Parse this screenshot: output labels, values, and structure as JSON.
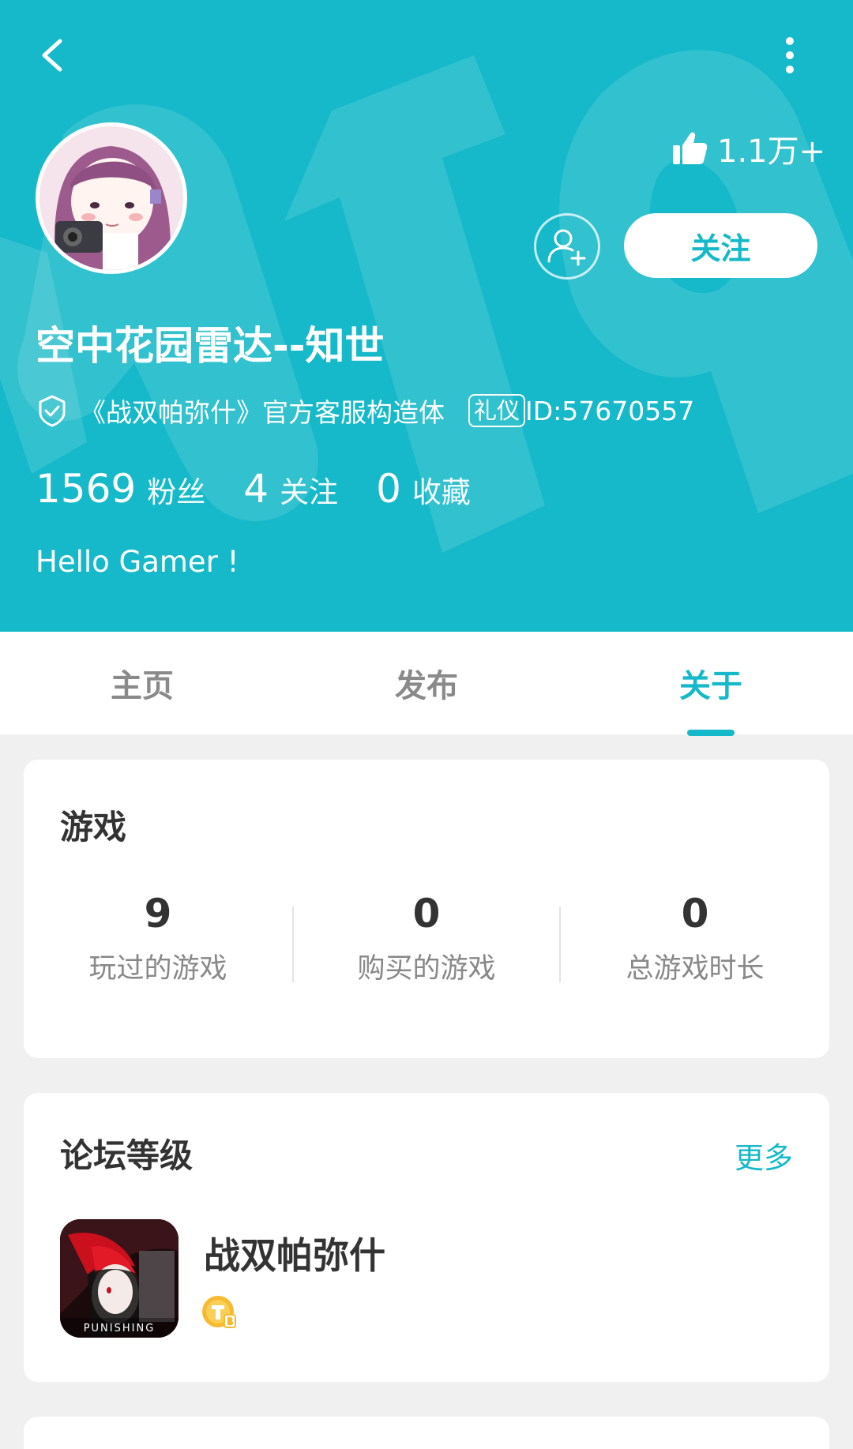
{
  "header": {
    "bg_color": "#15b9c9",
    "likes": "1.1万+",
    "follow_label": "关注",
    "username": "空中花园雷达--知世",
    "verify_text": "《战双帕弥什》官方客服构造体",
    "tag_badge": "礼仪",
    "user_id": "ID:57670557",
    "stats": [
      {
        "value": "1569",
        "label": "粉丝"
      },
      {
        "value": "4",
        "label": "关注"
      },
      {
        "value": "0",
        "label": "收藏"
      }
    ],
    "bio": "Hello Gamer !"
  },
  "tabs": [
    {
      "label": "主页",
      "active": false
    },
    {
      "label": "发布",
      "active": false
    },
    {
      "label": "关于",
      "active": true
    }
  ],
  "games_card": {
    "title": "游戏",
    "stats": [
      {
        "value": "9",
        "label": "玩过的游戏"
      },
      {
        "value": "0",
        "label": "购买的游戏"
      },
      {
        "value": "0",
        "label": "总游戏时长"
      }
    ]
  },
  "forum_card": {
    "title": "论坛等级",
    "more_label": "更多",
    "game_name": "战双帕弥什",
    "icon_text": "PUNISHING"
  },
  "icons": [
    "back-arrow-icon",
    "more-vertical-icon",
    "thumbs-up-icon",
    "add-friend-icon",
    "verified-shield-icon",
    "level-coin-icon"
  ],
  "accent_color": "#15b9c9"
}
